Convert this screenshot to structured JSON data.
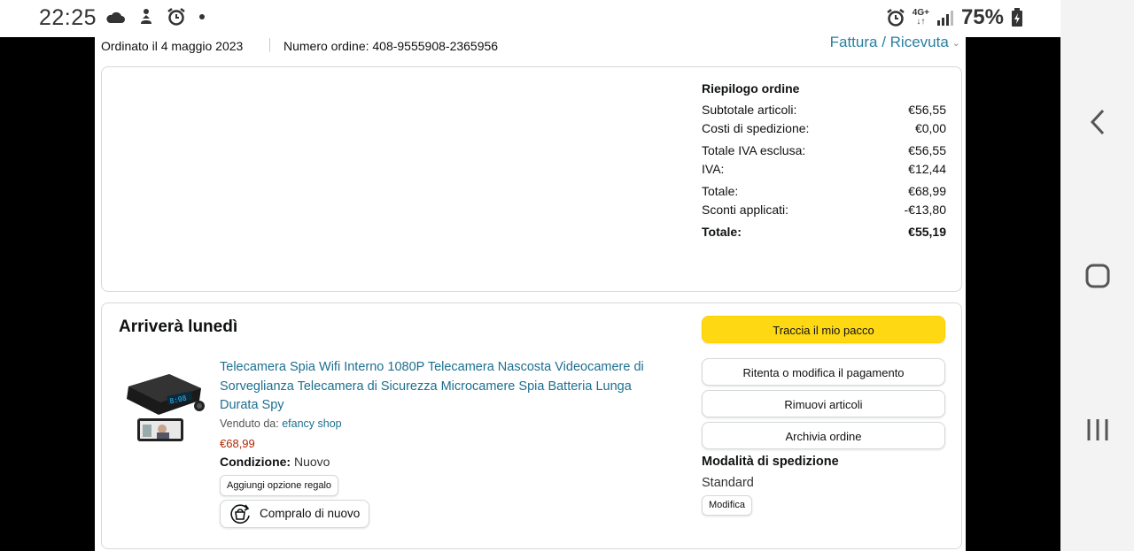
{
  "status_bar": {
    "time": "22:25",
    "network": "4G+",
    "battery": "75%"
  },
  "order": {
    "date_text": "Ordinato il 4 maggio 2023",
    "number_text": "Numero ordine: 408-9555908-2365956",
    "invoice_link": "Fattura / Ricevuta"
  },
  "summary": {
    "title": "Riepilogo ordine",
    "rows": [
      {
        "label": "Subtotale articoli:",
        "value": "€56,55"
      },
      {
        "label": "Costi di spedizione:",
        "value": "€0,00"
      },
      {
        "label": "Totale IVA esclusa:",
        "value": "€56,55"
      },
      {
        "label": "IVA:",
        "value": "€12,44"
      },
      {
        "label": "Totale:",
        "value": "€68,99"
      },
      {
        "label": "Sconti applicati:",
        "value": "-€13,80"
      }
    ],
    "grand_total": {
      "label": "Totale:",
      "value": "€55,19"
    }
  },
  "delivery": {
    "heading": "Arriverà lunedì",
    "product": {
      "title": "Telecamera Spia Wifi Interno 1080P Telecamera Nascosta Videocamere di Sorveglianza Telecamera di Sicurezza Microcamere Spia Batteria Lunga Durata Spy",
      "seller_label": "Venduto da:",
      "seller_name": "efancy shop",
      "price": "€68,99",
      "condition_label": "Condizione:",
      "condition_value": "Nuovo",
      "gift_button": "Aggiungi opzione regalo",
      "buy_again_button": "Compralo di nuovo"
    },
    "actions": {
      "track": "Traccia il mio pacco",
      "retry_payment": "Ritenta o modifica il pagamento",
      "remove_items": "Rimuovi articoli",
      "archive": "Archivia ordine"
    },
    "shipping": {
      "title": "Modalità di spedizione",
      "value": "Standard",
      "edit_button": "Modifica"
    }
  },
  "colors": {
    "link": "#1d6f8f",
    "price": "#b12704",
    "primary_button": "#ffd814"
  }
}
